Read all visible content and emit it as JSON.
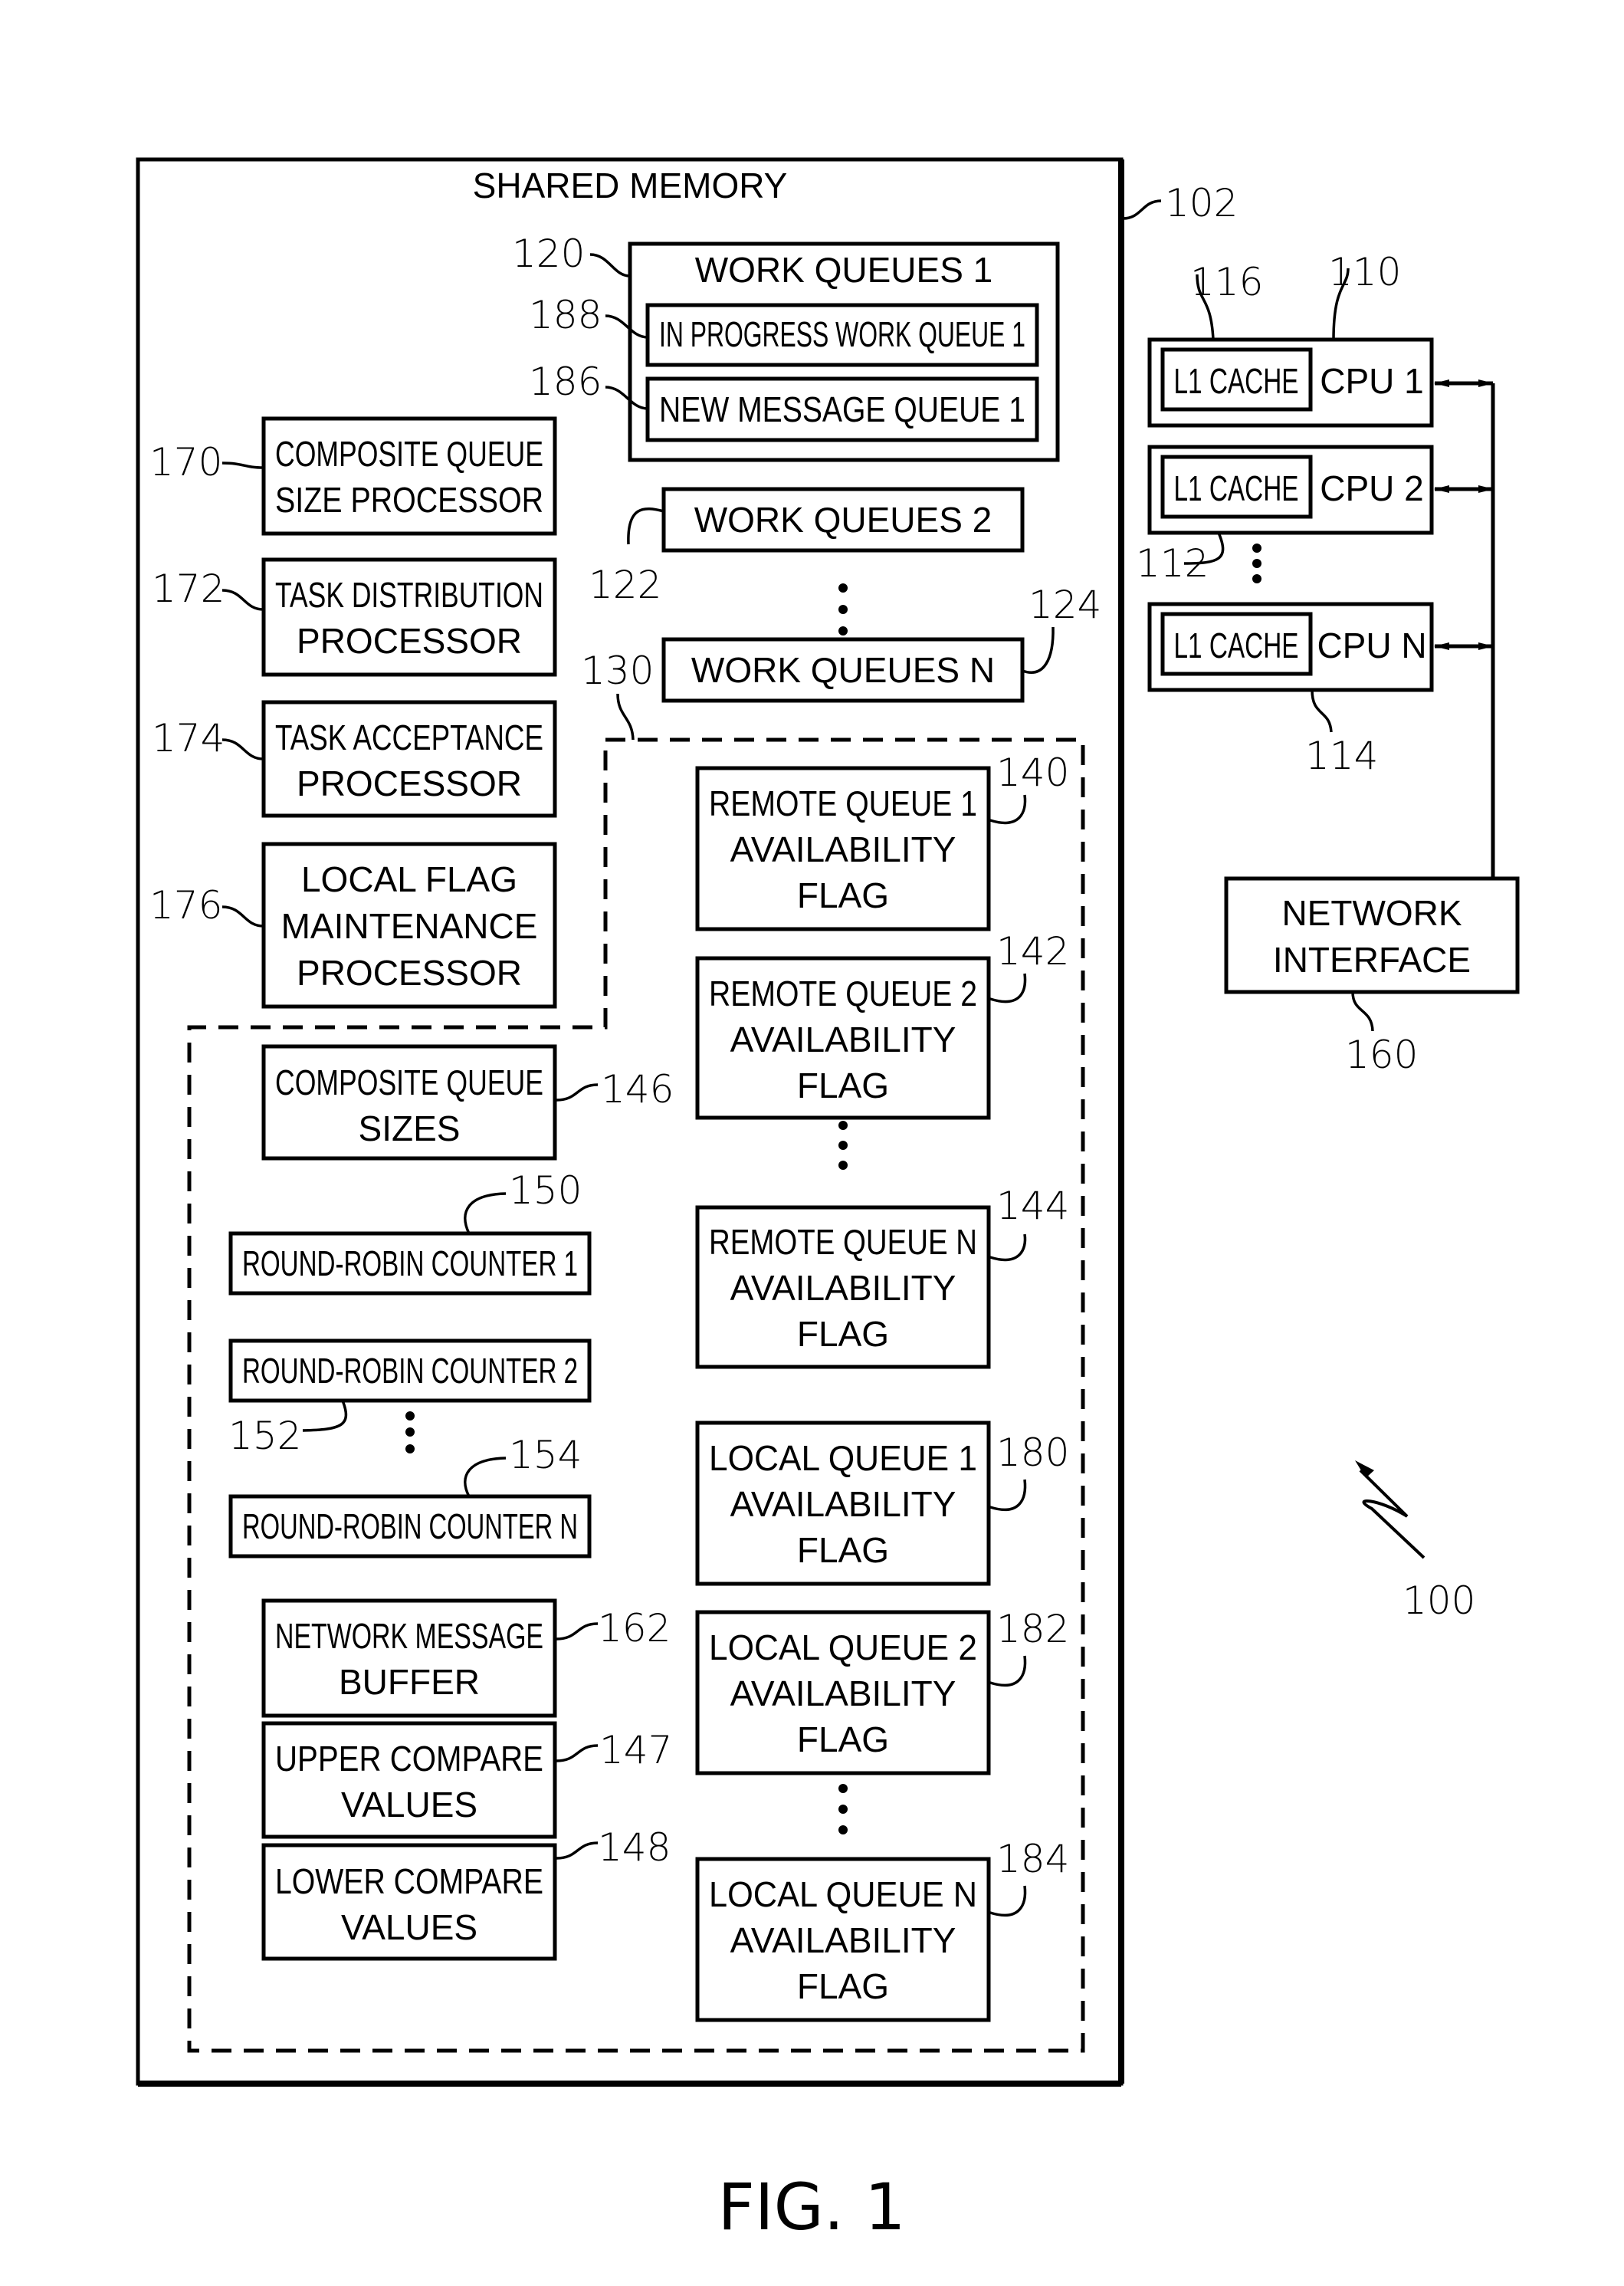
{
  "figure": {
    "caption": "FIG. 1",
    "system_ref": "100"
  },
  "shared_memory": {
    "title": "SHARED MEMORY",
    "ref": "102",
    "work_queues": [
      {
        "label": "WORK QUEUES 1",
        "ref": "120"
      },
      {
        "label": "WORK QUEUES 2",
        "ref": "122"
      },
      {
        "label": "WORK QUEUES N",
        "ref": "124"
      }
    ],
    "work_queue_1_sub": [
      {
        "label": "IN PROGRESS WORK QUEUE 1",
        "ref": "188"
      },
      {
        "label": "NEW MESSAGE QUEUE 1",
        "ref": "186"
      }
    ],
    "processors": [
      {
        "lines": [
          "COMPOSITE QUEUE",
          "SIZE PROCESSOR"
        ],
        "ref": "170"
      },
      {
        "lines": [
          "TASK DISTRIBUTION",
          "PROCESSOR"
        ],
        "ref": "172"
      },
      {
        "lines": [
          "TASK ACCEPTANCE",
          "PROCESSOR"
        ],
        "ref": "174"
      },
      {
        "lines": [
          "LOCAL FLAG",
          "MAINTENANCE",
          "PROCESSOR"
        ],
        "ref": "176"
      }
    ],
    "region_130": {
      "ref": "130",
      "left_column": [
        {
          "lines": [
            "COMPOSITE QUEUE",
            "SIZES"
          ],
          "ref": "146"
        },
        {
          "lines": [
            "ROUND-ROBIN COUNTER 1"
          ],
          "ref": "150"
        },
        {
          "lines": [
            "ROUND-ROBIN COUNTER 2"
          ],
          "ref": "152"
        },
        {
          "lines": [
            "ROUND-ROBIN COUNTER N"
          ],
          "ref": "154"
        },
        {
          "lines": [
            "NETWORK MESSAGE",
            "BUFFER"
          ],
          "ref": "162"
        },
        {
          "lines": [
            "UPPER COMPARE",
            "VALUES"
          ],
          "ref": "147"
        },
        {
          "lines": [
            "LOWER COMPARE",
            "VALUES"
          ],
          "ref": "148"
        }
      ],
      "right_column": [
        {
          "lines": [
            "REMOTE QUEUE 1",
            "AVAILABILITY",
            "FLAG"
          ],
          "ref": "140"
        },
        {
          "lines": [
            "REMOTE QUEUE 2",
            "AVAILABILITY",
            "FLAG"
          ],
          "ref": "142"
        },
        {
          "lines": [
            "REMOTE QUEUE N",
            "AVAILABILITY",
            "FLAG"
          ],
          "ref": "144"
        },
        {
          "lines": [
            "LOCAL QUEUE 1",
            "AVAILABILITY",
            "FLAG"
          ],
          "ref": "180"
        },
        {
          "lines": [
            "LOCAL QUEUE 2",
            "AVAILABILITY",
            "FLAG"
          ],
          "ref": "182"
        },
        {
          "lines": [
            "LOCAL QUEUE N",
            "AVAILABILITY",
            "FLAG"
          ],
          "ref": "184"
        }
      ]
    }
  },
  "cpus": [
    {
      "cache_label": "L1 CACHE",
      "cpu_label": "CPU 1",
      "ref": "110",
      "cache_ref": "116"
    },
    {
      "cache_label": "L1 CACHE",
      "cpu_label": "CPU 2",
      "ref": "112"
    },
    {
      "cache_label": "L1 CACHE",
      "cpu_label": "CPU N",
      "ref": "114"
    }
  ],
  "network_interface": {
    "lines": [
      "NETWORK",
      "INTERFACE"
    ],
    "ref": "160"
  }
}
